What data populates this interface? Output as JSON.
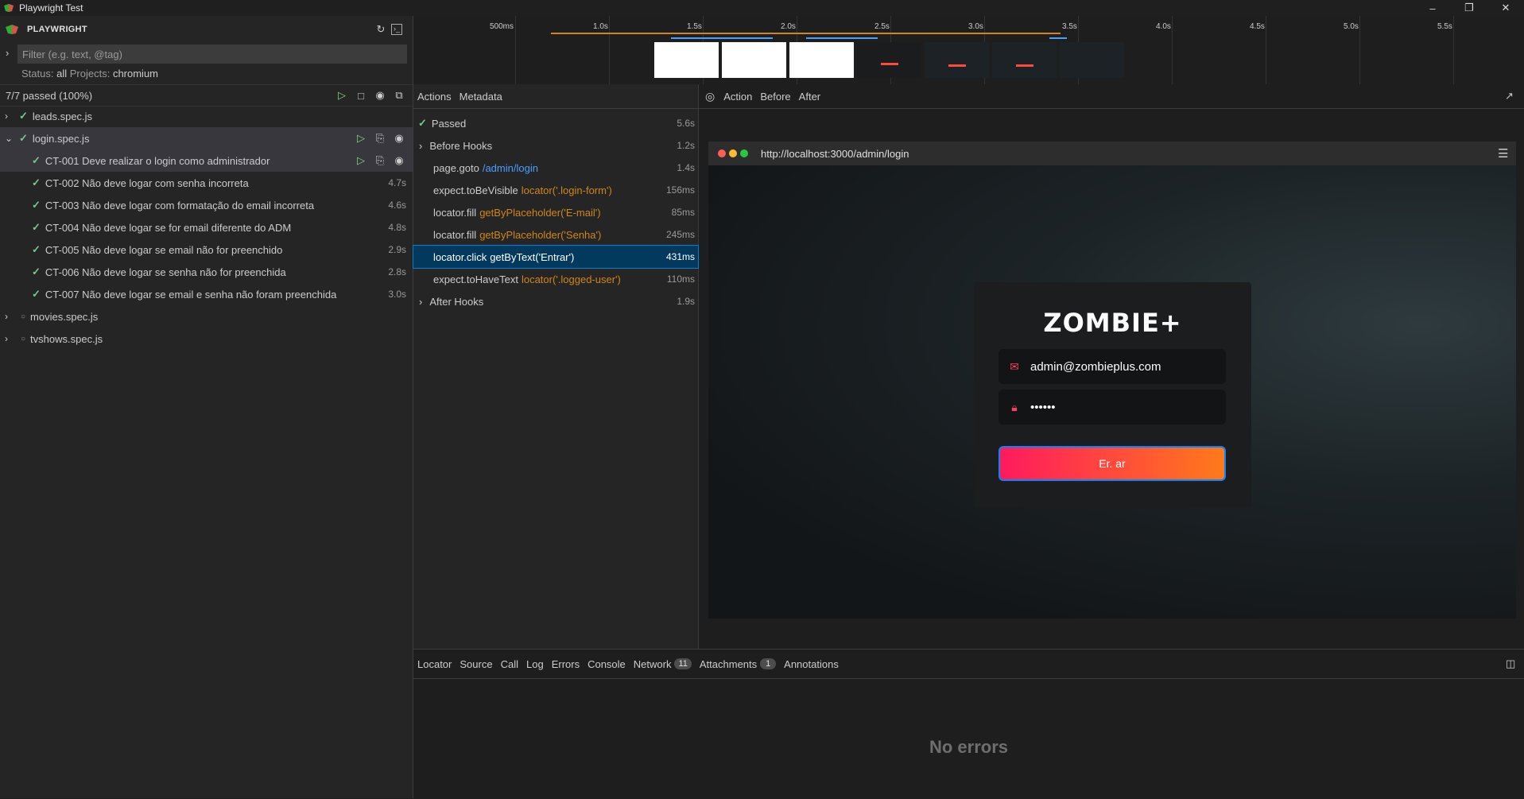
{
  "window": {
    "title": "Playwright Test",
    "min": "–",
    "max": "❐",
    "close": "✕"
  },
  "sidebar": {
    "brand": "PLAYWRIGHT",
    "filter_placeholder": "Filter (e.g. text, @tag)",
    "status_label": "Status:",
    "status_value": "all",
    "projects_label": "Projects:",
    "projects_value": "chromium",
    "summary": "7/7 passed (100%)",
    "files": [
      {
        "name": "leads.spec.js",
        "state": "passed"
      },
      {
        "name": "login.spec.js",
        "state": "passed",
        "expanded": true
      },
      {
        "name": "movies.spec.js",
        "state": "none"
      },
      {
        "name": "tvshows.spec.js",
        "state": "none"
      }
    ],
    "tests": [
      {
        "name": "CT-001 Deve realizar o login como administrador",
        "duration": ""
      },
      {
        "name": "CT-002 Não deve logar com senha incorreta",
        "duration": "4.7s"
      },
      {
        "name": "CT-003 Não deve logar com formatação do email incorreta",
        "duration": "4.6s"
      },
      {
        "name": "CT-004 Não deve logar se for email diferente do ADM",
        "duration": "4.8s"
      },
      {
        "name": "CT-005 Não deve logar se email não for preenchido",
        "duration": "2.9s"
      },
      {
        "name": "CT-006 Não deve logar se senha não for preenchida",
        "duration": "2.8s"
      },
      {
        "name": "CT-007 Não deve logar se email e senha não foram preenchida",
        "duration": "3.0s"
      }
    ]
  },
  "timeline": {
    "ticks": [
      "500ms",
      "1.0s",
      "1.5s",
      "2.0s",
      "2.5s",
      "3.0s",
      "3.5s",
      "4.0s",
      "4.5s",
      "5.0s",
      "5.5s"
    ]
  },
  "actions_panel": {
    "tabs": [
      "Actions",
      "Metadata"
    ],
    "rows": [
      {
        "title": "Passed",
        "arg": "",
        "duration": "5.6s"
      },
      {
        "title": "Before Hooks",
        "arg": "",
        "duration": "1.2s"
      },
      {
        "title": "page.goto",
        "arg": "/admin/login",
        "duration": "1.4s"
      },
      {
        "title": "expect.toBeVisible",
        "arg": "locator('.login-form')",
        "duration": "156ms"
      },
      {
        "title": "locator.fill",
        "arg": "getByPlaceholder('E-mail')",
        "duration": "85ms"
      },
      {
        "title": "locator.fill",
        "arg": "getByPlaceholder('Senha')",
        "duration": "245ms"
      },
      {
        "title": "locator.click",
        "arg": "getByText('Entrar')",
        "duration": "431ms"
      },
      {
        "title": "expect.toHaveText",
        "arg": "locator('.logged-user')",
        "duration": "110ms"
      },
      {
        "title": "After Hooks",
        "arg": "",
        "duration": "1.9s"
      }
    ]
  },
  "snapshot": {
    "tabs": [
      "Action",
      "Before",
      "After"
    ],
    "url": "http://localhost:3000/admin/login",
    "logo": "ZOMBIE+",
    "email_value": "admin@zombieplus.com",
    "password_value": "••••••",
    "button_label": "Er.  ar"
  },
  "bottom": {
    "tabs": [
      {
        "label": "Locator"
      },
      {
        "label": "Source"
      },
      {
        "label": "Call"
      },
      {
        "label": "Log"
      },
      {
        "label": "Errors"
      },
      {
        "label": "Console"
      },
      {
        "label": "Network",
        "count": "11"
      },
      {
        "label": "Attachments",
        "count": "1"
      },
      {
        "label": "Annotations"
      }
    ],
    "message": "No errors"
  },
  "colors": {
    "pass": "#73c991",
    "accent": "#007fd4",
    "orange": "#d18616",
    "link": "#4a9eff"
  }
}
